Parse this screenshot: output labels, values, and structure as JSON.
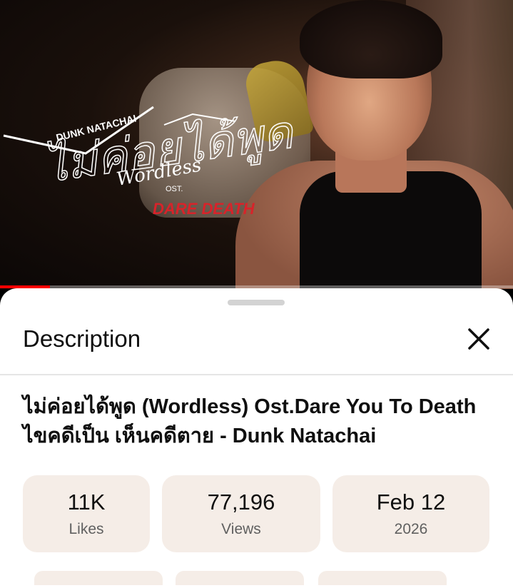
{
  "video": {
    "artist_text": "DUNK NATACHAI",
    "thai_title_art": "ไม่ค่อยได้พูด",
    "english_title_art": "Wordless",
    "ost_text": "OST.",
    "show_logo_text": "DARE DEATH",
    "progress": 0.097
  },
  "description_sheet": {
    "header_title": "Description",
    "close_icon": "close-icon",
    "video_title_line1": "ไม่ค่อยได้พูด (Wordless) Ost.Dare You To Death",
    "video_title_line2": "ไขคดีเป็น เห็นคดีตาย - Dunk Natachai",
    "stats": [
      {
        "value": "11K",
        "label": "Likes"
      },
      {
        "value": "77,196",
        "label": "Views"
      },
      {
        "value": "Feb 12",
        "label": "2026"
      }
    ]
  },
  "colors": {
    "progress_red": "#ff0000",
    "stat_bg": "#f5ede7"
  }
}
